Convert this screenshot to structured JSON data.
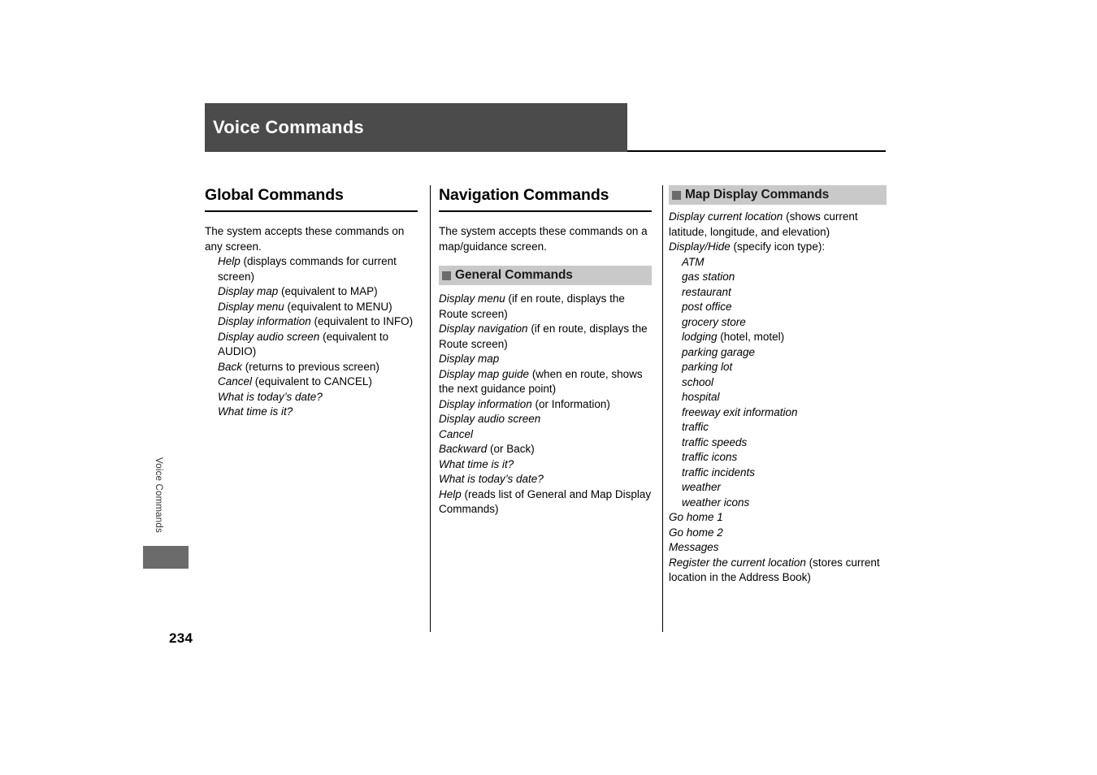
{
  "header": {
    "title": "Voice Commands"
  },
  "side_tab": {
    "label": "Voice Commands"
  },
  "page_number": "234",
  "colors": {
    "header_bar": "#4b4b4b",
    "section_header_bg": "#c9c9c9",
    "section_bullet": "#6b6b6b",
    "tab_block": "#6b6b6b"
  },
  "columns": {
    "global": {
      "heading": "Global Commands",
      "intro": "The system accepts these commands on any screen.",
      "items": [
        {
          "term": "Help",
          "note": " (displays commands for current screen)"
        },
        {
          "term": "Display map",
          "note": " (equivalent to MAP)"
        },
        {
          "term": "Display menu",
          "note": " (equivalent to MENU)"
        },
        {
          "term": "Display information",
          "note": " (equivalent to INFO)"
        },
        {
          "term": "Display audio screen",
          "note": " (equivalent to AUDIO)"
        },
        {
          "term": "Back",
          "note": " (returns to previous screen)"
        },
        {
          "term": "Cancel",
          "note": " (equivalent to CANCEL)"
        },
        {
          "term": "What is today’s date?",
          "note": ""
        },
        {
          "term": "What time is it?",
          "note": ""
        }
      ]
    },
    "navigation": {
      "heading": "Navigation Commands",
      "intro": "The system accepts these commands on a map/guidance screen.",
      "section": {
        "title": "General Commands",
        "items": [
          {
            "term": "Display menu",
            "note": " (if en route, displays the Route screen)"
          },
          {
            "term": "Display navigation",
            "note": " (if en route, displays the Route screen)"
          },
          {
            "term": "Display map",
            "note": ""
          },
          {
            "term": "Display map guide",
            "note": " (when en route, shows the next guidance point)"
          },
          {
            "term": "Display information",
            "note": " (or Information)"
          },
          {
            "term": "Display audio screen",
            "note": ""
          },
          {
            "term": "Cancel",
            "note": ""
          },
          {
            "term": "Backward",
            "note": " (or Back)"
          },
          {
            "term": "What time is it?",
            "note": ""
          },
          {
            "term": "What is today’s date?",
            "note": ""
          },
          {
            "term": "Help",
            "note": " (reads list of General and Map Display Commands)"
          }
        ]
      }
    },
    "map_display": {
      "section": {
        "title": "Map Display Commands",
        "items": [
          {
            "term": "Display current location",
            "note": " (shows current latitude, longitude, and elevation)",
            "indent": false
          },
          {
            "term": "Display/Hide",
            "note": " (specify icon type):",
            "indent": false
          },
          {
            "term": "ATM",
            "note": "",
            "indent": true
          },
          {
            "term": "gas station",
            "note": "",
            "indent": true
          },
          {
            "term": "restaurant",
            "note": "",
            "indent": true
          },
          {
            "term": "post office",
            "note": "",
            "indent": true
          },
          {
            "term": "grocery store",
            "note": "",
            "indent": true
          },
          {
            "term": "lodging",
            "note": " (hotel, motel)",
            "indent": true
          },
          {
            "term": "parking garage",
            "note": "",
            "indent": true
          },
          {
            "term": "parking lot",
            "note": "",
            "indent": true
          },
          {
            "term": "school",
            "note": "",
            "indent": true
          },
          {
            "term": "hospital",
            "note": "",
            "indent": true
          },
          {
            "term": "freeway exit information",
            "note": "",
            "indent": true
          },
          {
            "term": "traffic",
            "note": "",
            "indent": true
          },
          {
            "term": "traffic speeds",
            "note": "",
            "indent": true
          },
          {
            "term": "traffic icons",
            "note": "",
            "indent": true
          },
          {
            "term": "traffic incidents",
            "note": "",
            "indent": true
          },
          {
            "term": "weather",
            "note": "",
            "indent": true
          },
          {
            "term": "weather icons",
            "note": "",
            "indent": true
          },
          {
            "term": "Go home 1",
            "note": "",
            "indent": false
          },
          {
            "term": "Go home 2",
            "note": "",
            "indent": false
          },
          {
            "term": "Messages",
            "note": "",
            "indent": false
          },
          {
            "term": "Register the current location",
            "note": " (stores current location in the Address Book)",
            "indent": false
          }
        ]
      }
    }
  }
}
